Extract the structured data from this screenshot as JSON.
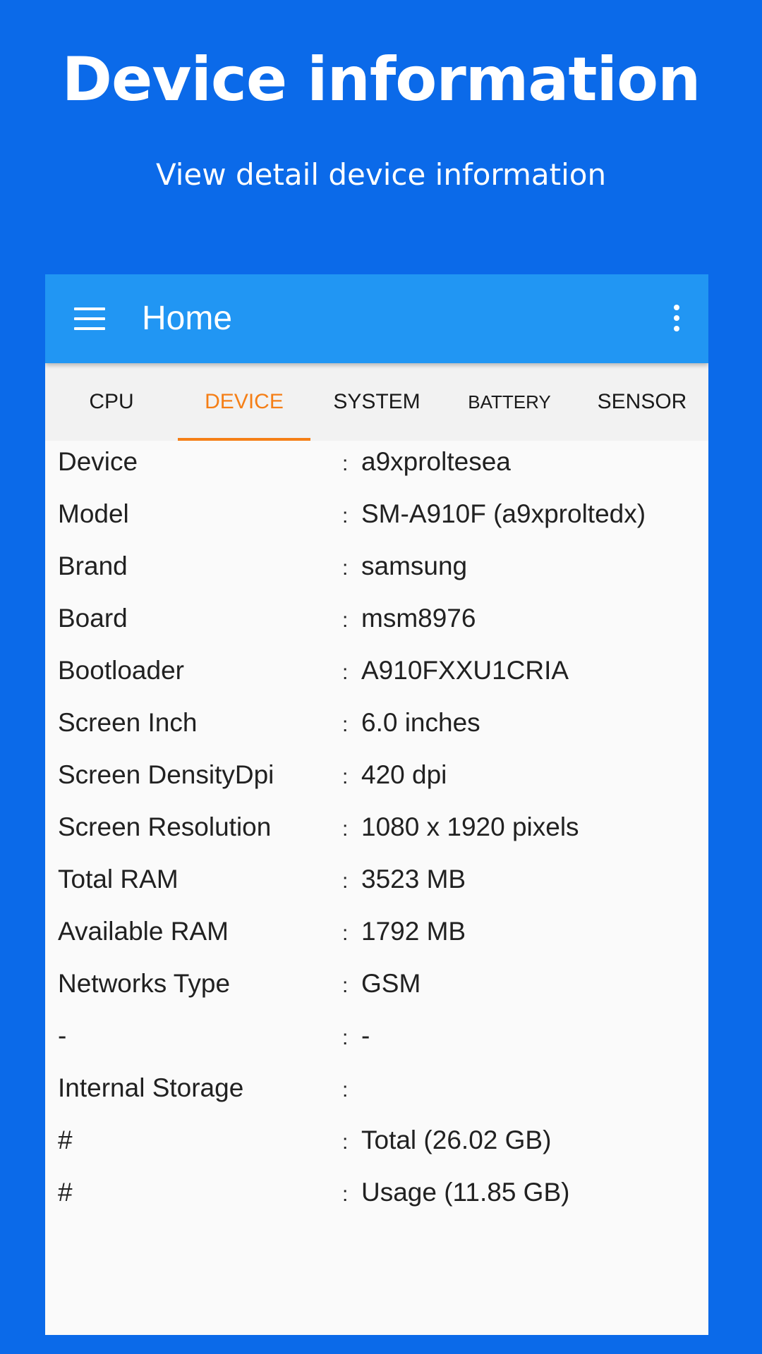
{
  "promo": {
    "title": "Device information",
    "subtitle": "View detail device information"
  },
  "app_bar": {
    "title": "Home",
    "menu_icon": "hamburger-menu-icon",
    "overflow_icon": "more-vertical-icon"
  },
  "tabs": [
    {
      "label": "CPU",
      "active": false
    },
    {
      "label": "DEVICE",
      "active": true
    },
    {
      "label": "SYSTEM",
      "active": false
    },
    {
      "label": "BATTERY",
      "active": false
    },
    {
      "label": "SENSOR",
      "active": false
    }
  ],
  "separator": ":",
  "rows": [
    {
      "label": "Device",
      "value": "a9xproltesea"
    },
    {
      "label": "Model",
      "value": "SM-A910F (a9xproltedx)"
    },
    {
      "label": "Brand",
      "value": "samsung"
    },
    {
      "label": "Board",
      "value": "msm8976"
    },
    {
      "label": "Bootloader",
      "value": "A910FXXU1CRIA"
    },
    {
      "label": "Screen Inch",
      "value": "6.0 inches"
    },
    {
      "label": "Screen DensityDpi",
      "value": "420 dpi"
    },
    {
      "label": "Screen Resolution",
      "value": "1080 x 1920 pixels"
    },
    {
      "label": "Total RAM",
      "value": "3523 MB"
    },
    {
      "label": "Available RAM",
      "value": "1792 MB"
    },
    {
      "label": "Networks Type",
      "value": "GSM"
    },
    {
      "label": "-",
      "value": "-"
    },
    {
      "label": "Internal Storage",
      "value": ""
    },
    {
      "label": "#",
      "value": "Total (26.02 GB)"
    },
    {
      "label": "#",
      "value": "Usage (11.85 GB)"
    }
  ],
  "colors": {
    "background": "#0b6ae9",
    "app_bar": "#2196f3",
    "tab_active": "#f57f17",
    "tab_bar": "#f2f2f2",
    "content": "#fafafa"
  }
}
